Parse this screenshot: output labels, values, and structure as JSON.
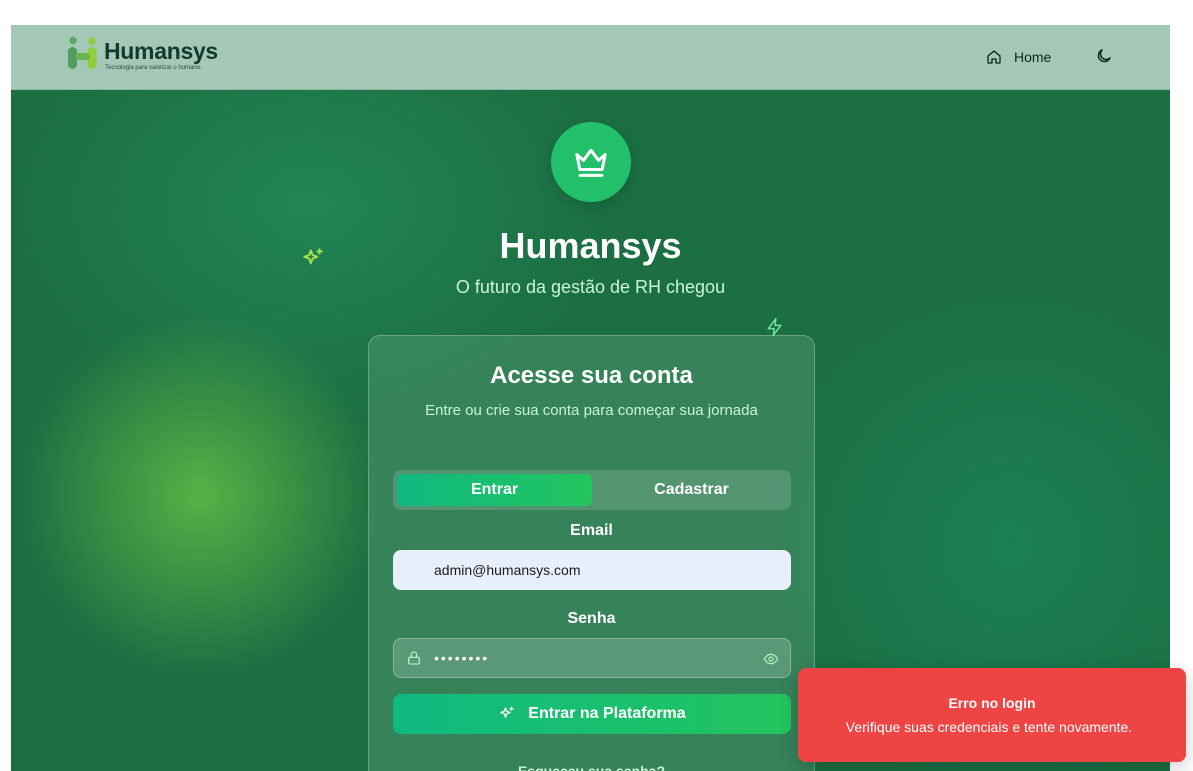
{
  "header": {
    "brand_name": "Humansys",
    "brand_tagline": "Tecnologia para valorizar o humano.",
    "nav_home_label": "Home",
    "home_icon": "home-icon",
    "theme_icon": "moon-icon"
  },
  "hero": {
    "icon": "crown-icon",
    "title": "Humansys",
    "subtitle": "O futuro da gestão de RH chegou"
  },
  "login_card": {
    "title": "Acesse sua conta",
    "subtitle": "Entre ou crie sua conta para começar sua jornada",
    "tabs": [
      {
        "label": "Entrar",
        "active": true
      },
      {
        "label": "Cadastrar",
        "active": false
      }
    ],
    "email_label": "Email",
    "email_value": "admin@humansys.com",
    "password_label": "Senha",
    "password_value": "••••••••",
    "submit_label": "Entrar na Plataforma",
    "forgot_label": "Esqueceu sua senha?"
  },
  "toast": {
    "title": "Erro no login",
    "message": "Verifique suas credenciais e tente novamente.",
    "color": "#ef4444"
  },
  "colors": {
    "accent": "#22c55e",
    "accent_start": "#10b981",
    "background": "#1b6f43",
    "header_bg": "#a3c8b6"
  }
}
